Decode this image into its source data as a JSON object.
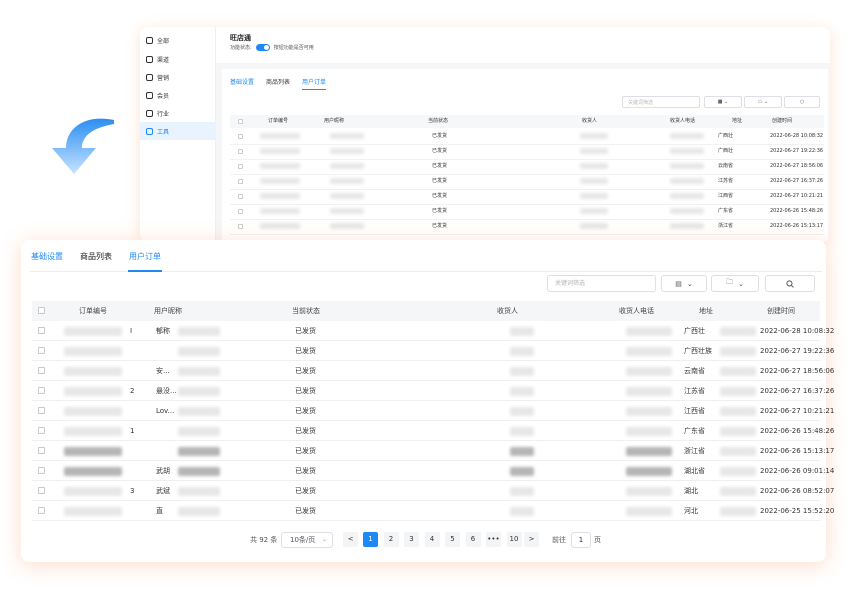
{
  "back_window": {
    "sidebar": [
      {
        "label": "全部",
        "icon": "home-icon"
      },
      {
        "label": "渠道",
        "icon": "channel-icon"
      },
      {
        "label": "营销",
        "icon": "marketing-icon"
      },
      {
        "label": "会员",
        "icon": "member-icon"
      },
      {
        "label": "行业",
        "icon": "industry-icon"
      },
      {
        "label": "工具",
        "icon": "tool-icon",
        "active": true
      }
    ],
    "title": "旺店通",
    "func_label": "功能状态:",
    "func_desc": "按钮功能是否可用",
    "tabs": [
      "基础设置",
      "商品列表",
      "用户订单"
    ],
    "search_placeholder": "关键词筛选",
    "columns": [
      "订单编号",
      "用户昵称",
      "当前状态",
      "收货人",
      "收货人电话",
      "地址",
      "创建时间"
    ],
    "rows": [
      {
        "status": "已发货",
        "address": "广西壮",
        "time": "2022-06-28 10:08:32"
      },
      {
        "status": "已发货",
        "address": "广西壮",
        "time": "2022-06-27 19:22:36"
      },
      {
        "status": "已发货",
        "address": "云南省",
        "time": "2022-06-27 18:56:06"
      },
      {
        "status": "已发货",
        "address": "江苏省",
        "time": "2022-06-27 16:37:26"
      },
      {
        "status": "已发货",
        "address": "江西省",
        "time": "2022-06-27 10:21:21"
      },
      {
        "status": "已发货",
        "address": "广东省",
        "time": "2022-06-26 15:48:26"
      },
      {
        "status": "已发货",
        "address": "浙江省",
        "time": "2022-06-26 15:13:17"
      }
    ]
  },
  "front_window": {
    "tabs": [
      {
        "label": "基础设置"
      },
      {
        "label": "商品列表"
      },
      {
        "label": "用户订单",
        "active": true
      }
    ],
    "search_placeholder": "关键词筛选",
    "columns": [
      "订单编号",
      "用户昵称",
      "当前状态",
      "收货人",
      "收货人电话",
      "地址",
      "创建时间"
    ],
    "rows": [
      {
        "order": "I",
        "nick": "郁称",
        "status": "已发货",
        "address": "广西壮",
        "time": "2022-06-28 10:08:32"
      },
      {
        "order": "",
        "nick": "",
        "status": "已发货",
        "address": "广西壮族",
        "time": "2022-06-27 19:22:36"
      },
      {
        "order": "",
        "nick": "安...",
        "status": "已发货",
        "address": "云南省",
        "time": "2022-06-27 18:56:06"
      },
      {
        "order": "2",
        "nick": "悬没...",
        "status": "已发货",
        "address": "江苏省",
        "time": "2022-06-27 16:37:26"
      },
      {
        "order": "",
        "nick": "Lov...",
        "status": "已发货",
        "address": "江西省",
        "time": "2022-06-27 10:21:21"
      },
      {
        "order": "1",
        "nick": "",
        "status": "已发货",
        "address": "广东省",
        "time": "2022-06-26 15:48:26"
      },
      {
        "order": "",
        "nick": "",
        "status": "已发货",
        "address": "浙江省",
        "time": "2022-06-26 15:13:17"
      },
      {
        "order": "",
        "nick": "武胡",
        "status": "已发货",
        "address": "湖北省",
        "time": "2022-06-26 09:01:14"
      },
      {
        "order": "3",
        "nick": "武斌",
        "status": "已发货",
        "address": "湖北",
        "time": "2022-06-26 08:52:07"
      },
      {
        "order": "",
        "nick": "直",
        "status": "已发货",
        "address": "河北",
        "time": "2022-06-25 15:52:20"
      }
    ],
    "pagination": {
      "total": "共 92 条",
      "page_size": "10条/页",
      "pages": [
        "1",
        "2",
        "3",
        "4",
        "5",
        "6",
        "•••",
        "10"
      ],
      "active_page": "1",
      "prev": "<",
      "next": ">",
      "goto_label": "前往",
      "goto_value": "1",
      "page_label": "页"
    }
  },
  "colors": {
    "accent": "#1e88f5",
    "glow": "#ffb27a",
    "arrow_top": "#2b8ef2",
    "arrow_bottom": "#bfe0ff"
  }
}
